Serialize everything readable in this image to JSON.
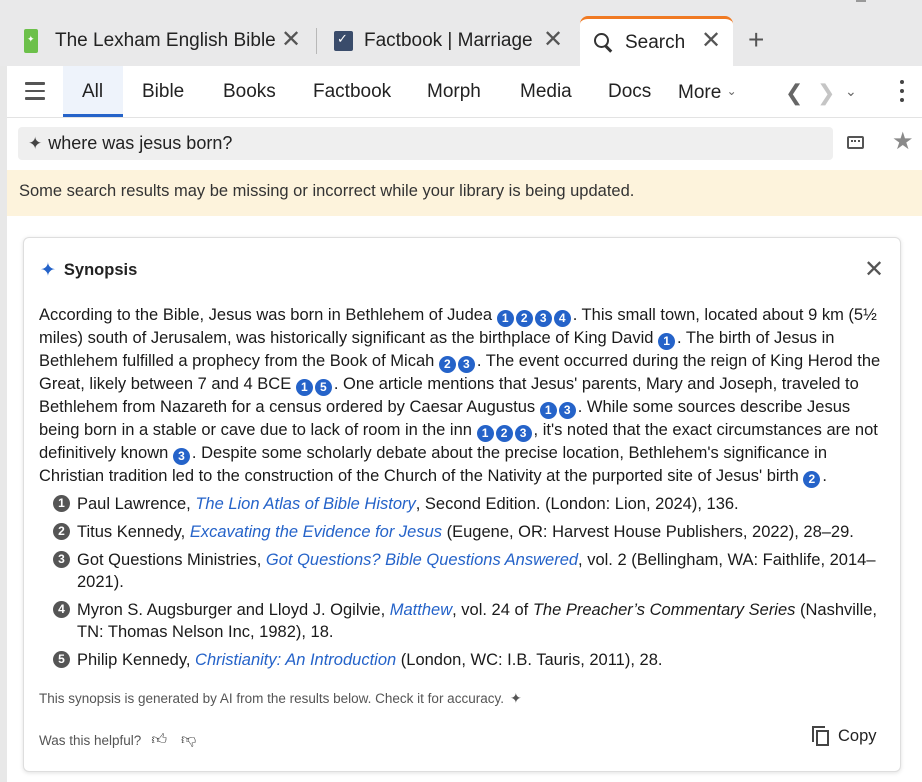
{
  "tabs": [
    {
      "title": "The Lexham English Bible",
      "icon": "lexham-book-icon",
      "active": false
    },
    {
      "title": "Factbook | Marriage",
      "icon": "factbook-icon",
      "active": false
    },
    {
      "title": "Search",
      "icon": "search-icon",
      "active": true
    }
  ],
  "tab_close_glyph": "✕",
  "new_tab_glyph": "+",
  "nav": {
    "tabs": [
      "All",
      "Bible",
      "Books",
      "Factbook",
      "Morph",
      "Media",
      "Docs",
      "More"
    ],
    "selected": "All"
  },
  "search": {
    "query": "where was jesus born?"
  },
  "notice": "Some search results may be missing or incorrect while your library is being updated.",
  "synopsis": {
    "title": "Synopsis",
    "disclaimer": "This synopsis is generated by AI from the results below. Check it for accuracy.",
    "helpful_label": "Was this helpful?",
    "copy_label": "Copy"
  },
  "colors": {
    "accent": "#2563c9",
    "active_tab_border": "#f07a23",
    "notice_bg": "#fdf3dc"
  }
}
